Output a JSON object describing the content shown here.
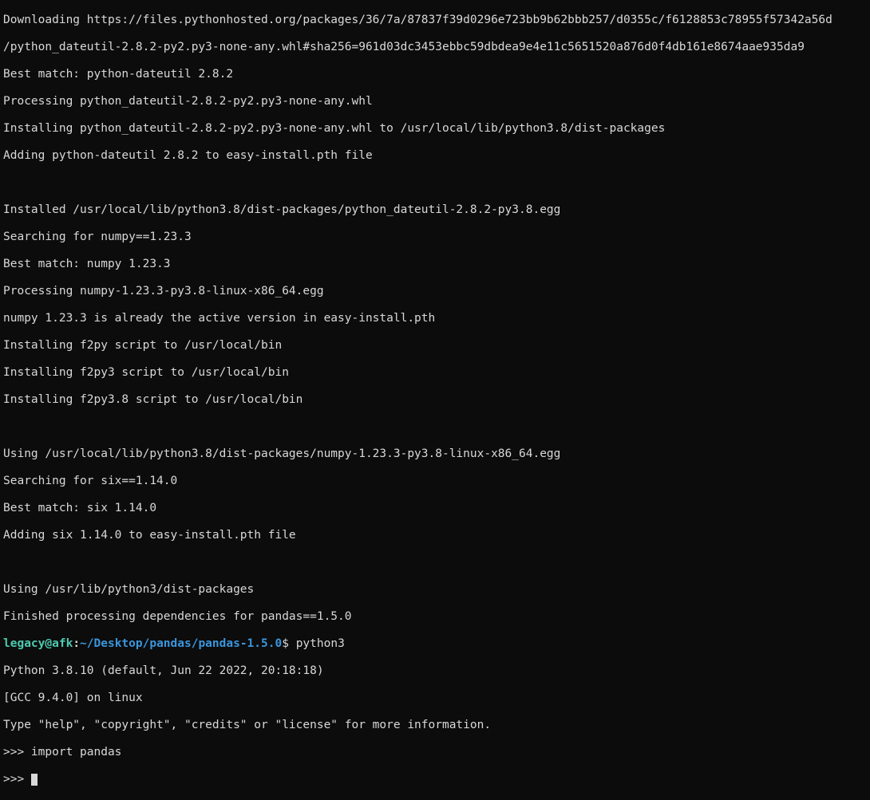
{
  "terminal": {
    "lines": [
      "Downloading https://files.pythonhosted.org/packages/36/7a/87837f39d0296e723bb9b62bbb257/d0355c/f6128853c78955f57342a56d",
      "/python_dateutil-2.8.2-py2.py3-none-any.whl#sha256=961d03dc3453ebbc59dbdea9e4e11c5651520a876d0f4db161e8674aae935da9",
      "Best match: python-dateutil 2.8.2",
      "Processing python_dateutil-2.8.2-py2.py3-none-any.whl",
      "Installing python_dateutil-2.8.2-py2.py3-none-any.whl to /usr/local/lib/python3.8/dist-packages",
      "Adding python-dateutil 2.8.2 to easy-install.pth file",
      "",
      "Installed /usr/local/lib/python3.8/dist-packages/python_dateutil-2.8.2-py3.8.egg",
      "Searching for numpy==1.23.3",
      "Best match: numpy 1.23.3",
      "Processing numpy-1.23.3-py3.8-linux-x86_64.egg",
      "numpy 1.23.3 is already the active version in easy-install.pth",
      "Installing f2py script to /usr/local/bin",
      "Installing f2py3 script to /usr/local/bin",
      "Installing f2py3.8 script to /usr/local/bin",
      "",
      "Using /usr/local/lib/python3.8/dist-packages/numpy-1.23.3-py3.8-linux-x86_64.egg",
      "Searching for six==1.14.0",
      "Best match: six 1.14.0",
      "Adding six 1.14.0 to easy-install.pth file",
      "",
      "Using /usr/lib/python3/dist-packages",
      "Finished processing dependencies for pandas==1.5.0"
    ],
    "prompt": {
      "user_host": "legacy@afk",
      "colon": ":",
      "path": "~/Desktop/pandas/pandas-1.5.0",
      "dollar": "$ ",
      "command": "python3"
    },
    "post_prompt_lines": [
      "Python 3.8.10 (default, Jun 22 2022, 20:18:18)",
      "[GCC 9.4.0] on linux",
      "Type \"help\", \"copyright\", \"credits\" or \"license\" for more information.",
      ">>> import pandas",
      ">>> "
    ]
  }
}
